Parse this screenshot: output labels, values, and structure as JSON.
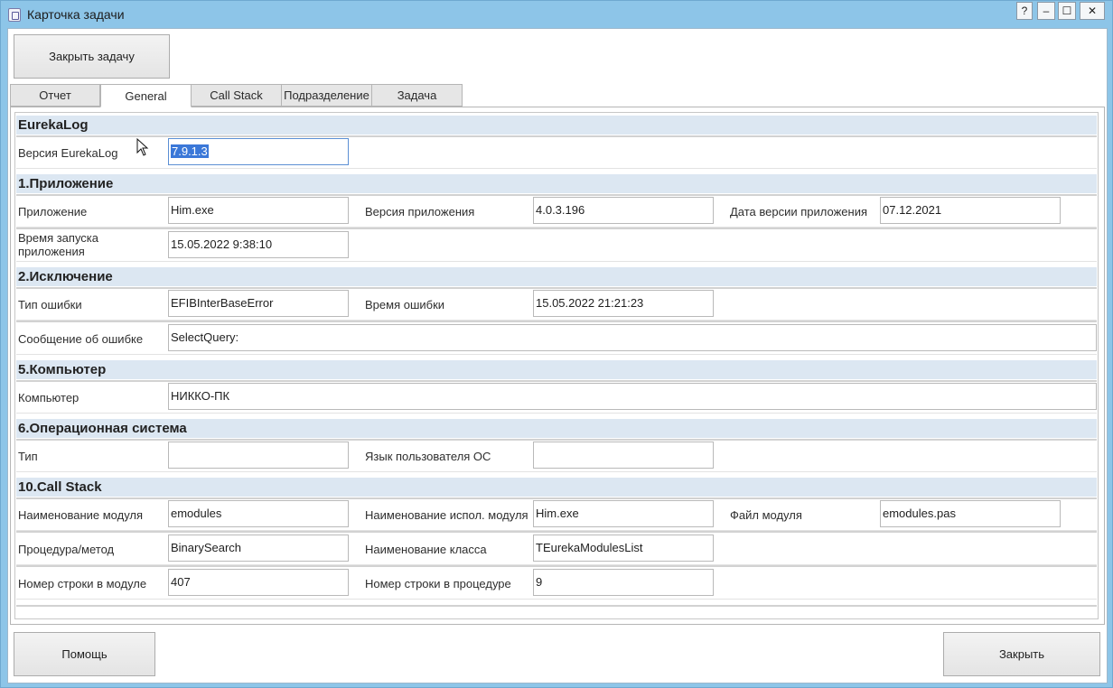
{
  "window": {
    "title": "Карточка задачи"
  },
  "sysbuttons": {
    "help": "?",
    "min": "–",
    "max": "☐",
    "close": "✕"
  },
  "toolbar": {
    "close_task": "Закрыть задачу"
  },
  "tabs": [
    {
      "label": "Отчет",
      "active": false
    },
    {
      "label": "General",
      "active": true
    },
    {
      "label": "Call Stack",
      "active": false
    },
    {
      "label": "Подразделение",
      "active": false
    },
    {
      "label": "Задача",
      "active": false
    }
  ],
  "sections": {
    "eurekalog": {
      "title": "EurekaLog",
      "version_label": "Версия EurekaLog",
      "version_value": "7.9.1.3"
    },
    "app": {
      "title": "1.Приложение",
      "app_label": "Приложение",
      "app_value": "Him.exe",
      "app_version_label": "Версия приложения",
      "app_version_value": "4.0.3.196",
      "app_date_label": "Дата версии приложения",
      "app_date_value": "07.12.2021",
      "start_time_label": "Время запуска приложения",
      "start_time_value": "15.05.2022 9:38:10"
    },
    "exception": {
      "title": "2.Исключение",
      "error_type_label": "Тип ошибки",
      "error_type_value": "EFIBInterBaseError",
      "error_time_label": "Время ошибки",
      "error_time_value": "15.05.2022 21:21:23",
      "error_msg_label": "Сообщение об ошибке",
      "error_msg_value": "SelectQuery:"
    },
    "computer": {
      "title": "5.Компьютер",
      "computer_label": "Компьютер",
      "computer_value": "НИККО-ПК"
    },
    "os": {
      "title": "6.Операционная система",
      "type_label": "Тип",
      "type_value": "",
      "lang_label": "Язык пользователя ОС",
      "lang_value": ""
    },
    "callstack": {
      "title": "10.Call Stack",
      "module_label": "Наименование модуля",
      "module_value": "emodules",
      "exec_module_label": "Наименование испол. модуля",
      "exec_module_value": "Him.exe",
      "module_file_label": "Файл модуля",
      "module_file_value": "emodules.pas",
      "procedure_label": "Процедура/метод",
      "procedure_value": "BinarySearch",
      "class_label": "Наименование класса",
      "class_value": "TEurekaModulesList",
      "line_module_label": "Номер строки в модуле",
      "line_module_value": "407",
      "line_proc_label": "Номер строки в процедуре",
      "line_proc_value": "9"
    }
  },
  "footer": {
    "help": "Помощь",
    "close": "Закрыть"
  }
}
